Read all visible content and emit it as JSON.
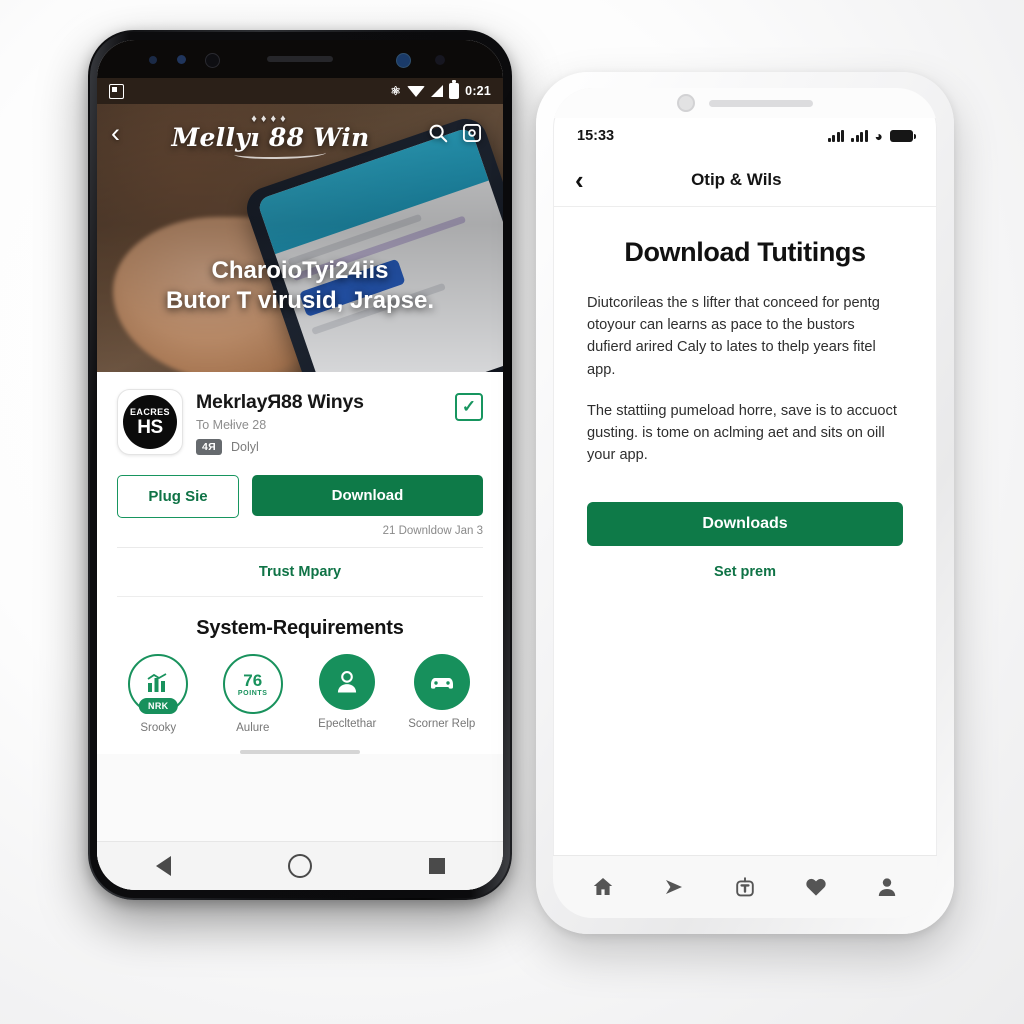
{
  "scene": {
    "background_color": "#f4f4f5",
    "accent_green": "#0e7a48",
    "accent_green_light": "#17905c"
  },
  "left_phone": {
    "platform": "android",
    "status_bar": {
      "sd_icon": "sd-card-icon",
      "bluetooth_icon": "bluetooth-icon",
      "wifi_icon": "wifi-icon",
      "signal_icon": "signal-icon",
      "battery_icon": "battery-icon",
      "time": "0:21"
    },
    "app_bar": {
      "back_icon": "back-chevron-icon",
      "brand_crown": "♦♦♦♦",
      "brand_name": "Mellyı 88 Win",
      "search_icon": "search-icon",
      "screenshot_icon": "screenshot-icon"
    },
    "hero": {
      "headline_line1": "CharoioTyi24iis",
      "headline_line2": "Butor T virusid, Jrapse."
    },
    "app_card": {
      "icon_text_top": "EACRES",
      "icon_text_bottom": "HS",
      "title": "MekrlayЯ88 Winys",
      "subtitle": "To Mełive 28",
      "badge": "4Я",
      "badge_label": "Dolyl",
      "checkbox_icon": "check-icon",
      "secondary_button": "Plug Sie",
      "primary_button": "Download",
      "download_note": "21 Downldow Jan 3",
      "trust_link": "Trust Mpary"
    },
    "system_requirements": {
      "title": "System-Requirements",
      "items": [
        {
          "icon": "chart-bars-icon",
          "badge": "NRK",
          "caption": "Srooky",
          "style": "ring"
        },
        {
          "icon": "score-number-icon",
          "number": "76",
          "number_sub": "POINTS",
          "caption": "Aulure",
          "style": "ring"
        },
        {
          "icon": "person-support-icon",
          "caption": "Epecltethar",
          "style": "fill"
        },
        {
          "icon": "car-icon",
          "caption": "Scorner Relp",
          "style": "fill"
        }
      ]
    },
    "nav_bar": {
      "back_icon": "nav-back-triangle-icon",
      "home_icon": "nav-home-circle-icon",
      "recents_icon": "nav-recents-square-icon"
    }
  },
  "right_phone": {
    "platform": "ios",
    "status_bar": {
      "time": "15:33",
      "signal_icon": "signal-bars-icon",
      "signal2_icon": "signal-bars-secondary-icon",
      "wifi_icon": "wifi-icon",
      "battery_icon": "battery-icon"
    },
    "app_bar": {
      "back_icon": "back-chevron-icon",
      "title": "Otip & Wils"
    },
    "content": {
      "heading": "Download Tutitings",
      "paragraph_1": "Diutcorileas the s lifter that conceed for pentg otoyour can learns as pace to the bustors dufierd arired Caly to lates to thelp years fitel app.",
      "paragraph_2": "The stattiing pumeload horre, save is to accuoct gusting. is tome on aclming aet and sits on oill your app.",
      "primary_button": "Downloads",
      "secondary_link": "Set prem"
    },
    "tab_bar": {
      "items": [
        {
          "icon": "home-icon"
        },
        {
          "icon": "send-icon"
        },
        {
          "icon": "bag-icon"
        },
        {
          "icon": "heart-icon"
        },
        {
          "icon": "profile-icon"
        }
      ]
    }
  }
}
